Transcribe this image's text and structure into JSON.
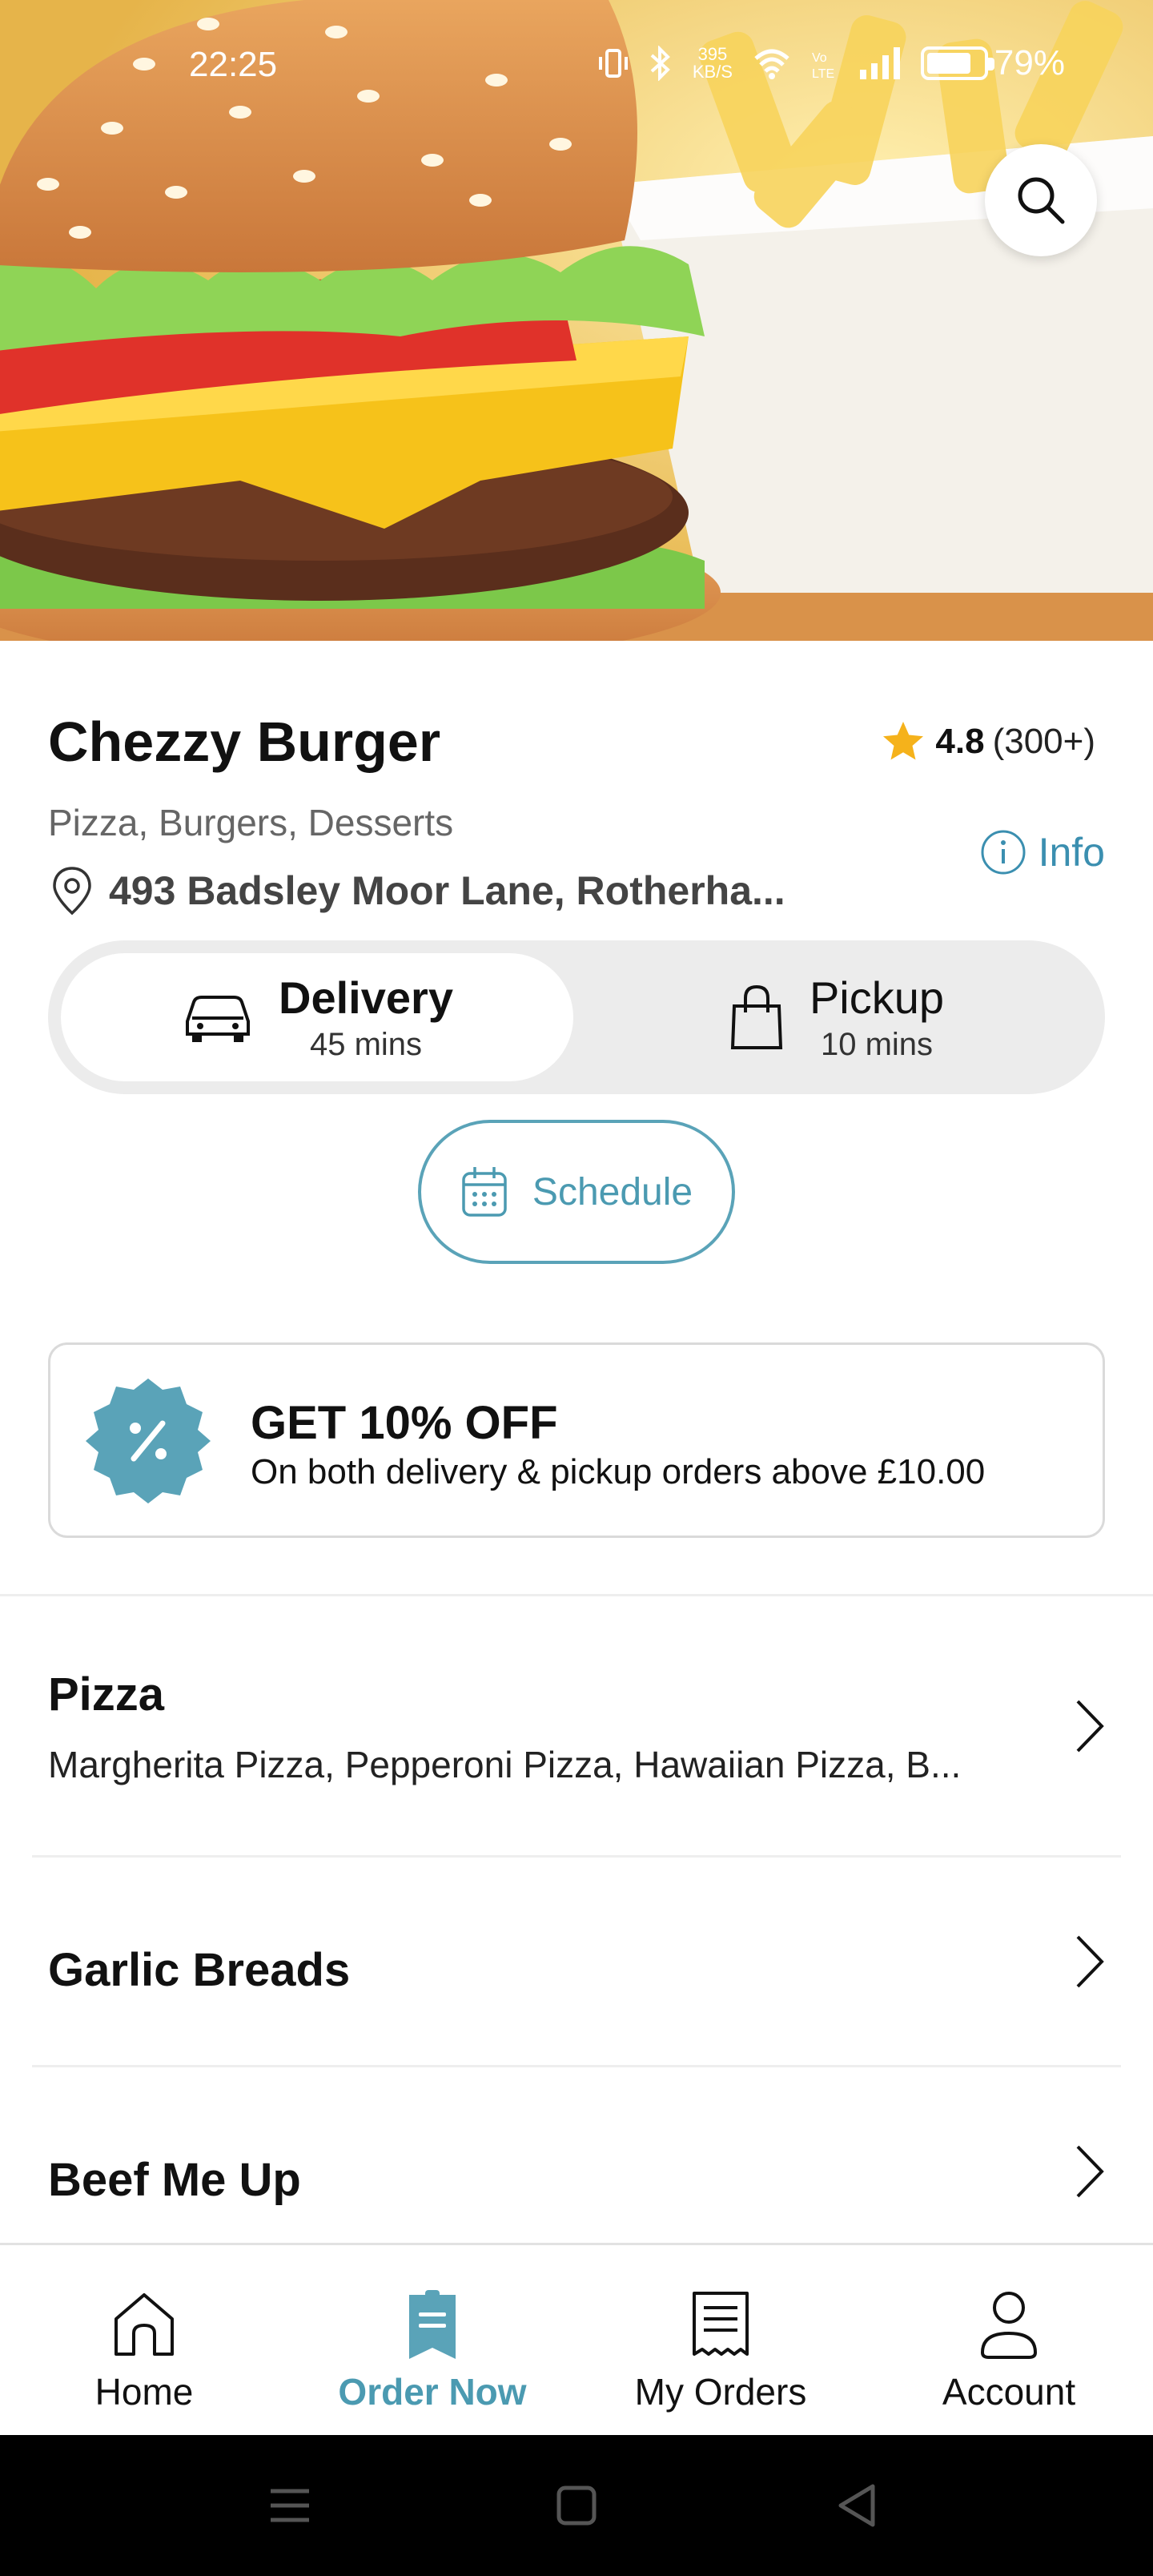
{
  "status_bar": {
    "time": "22:25",
    "net_speed": "395",
    "net_unit": "KB/S",
    "battery": "79%",
    "battery_level": 0.79
  },
  "restaurant": {
    "name": "Chezzy Burger",
    "rating": "4.8",
    "rating_count": "(300+)",
    "cuisines": "Pizza, Burgers, Desserts",
    "address": "493 Badsley Moor Lane, Rotherha...",
    "info_label": "Info"
  },
  "fulfillment": {
    "delivery_label": "Delivery",
    "delivery_time": "45 mins",
    "pickup_label": "Pickup",
    "pickup_time": "10 mins",
    "selected": "Delivery"
  },
  "schedule_label": "Schedule",
  "promo": {
    "title": "GET 10% OFF",
    "subtitle": "On both delivery & pickup orders above £10.00"
  },
  "menu_sections": [
    {
      "title": "Pizza",
      "description": "Margherita Pizza, Pepperoni Pizza, Hawaiian Pizza, B..."
    },
    {
      "title": "Garlic Breads"
    },
    {
      "title": "Beef Me Up"
    }
  ],
  "bottom_nav": [
    {
      "label": "Home",
      "icon": "home-icon"
    },
    {
      "label": "Order Now",
      "icon": "order-icon"
    },
    {
      "label": "My Orders",
      "icon": "receipt-icon"
    },
    {
      "label": "Account",
      "icon": "user-icon"
    }
  ],
  "colors": {
    "accent": "#4b9ab1",
    "star": "#f5b21b",
    "toggle_bg": "#ececec"
  }
}
